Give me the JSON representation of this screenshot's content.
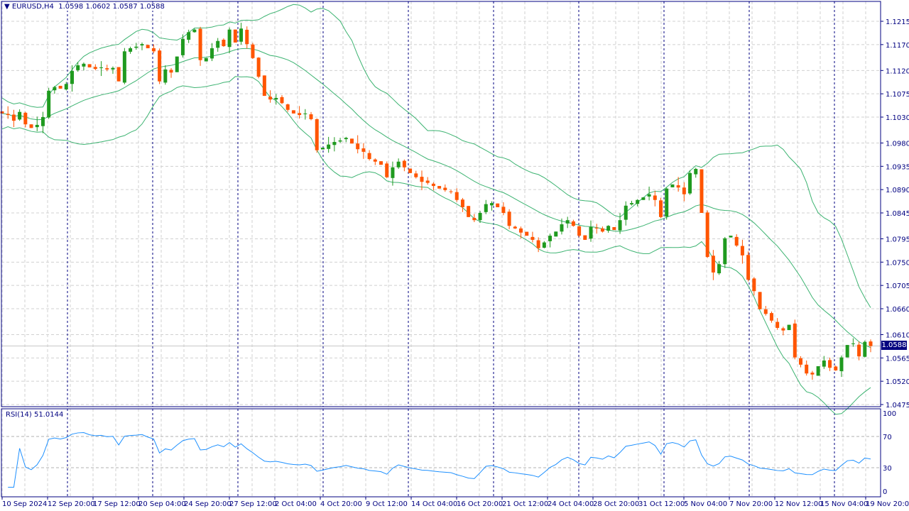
{
  "header": {
    "symbol": "EURUSD,H4",
    "open": "1.0598",
    "high": "1.0602",
    "low": "1.0587",
    "close": "1.0588"
  },
  "current_price_label": "1.0588",
  "rsi": {
    "label": "RSI(14) 51.0144",
    "period": 14,
    "levels": [
      30,
      70
    ]
  },
  "colors": {
    "axis": "#000080",
    "bull": "#1f9a1f",
    "bear": "#ff5500",
    "bands": "#3cb371",
    "rsi_line": "#1e90ff",
    "grid": "#d0d0d0"
  },
  "chart_data": {
    "type": "candlestick",
    "title": "EURUSD,H4",
    "indicators": [
      "Bollinger Bands(20,2)",
      "RSI(14)"
    ],
    "ylim": [
      1.0475,
      1.1215
    ],
    "price_ticks": [
      "1.1215",
      "1.1170",
      "1.1120",
      "1.1075",
      "1.1030",
      "1.0980",
      "1.0935",
      "1.0890",
      "1.0845",
      "1.0795",
      "1.0750",
      "1.0705",
      "1.0660",
      "1.0610",
      "1.0565",
      "1.0520",
      "1.0475"
    ],
    "rsi_ticks": [
      "100",
      "70",
      "30",
      "0"
    ],
    "time_ticks": [
      "10 Sep 2024",
      "12 Sep 20:00",
      "17 Sep 12:00",
      "20 Sep 04:00",
      "24 Sep 20:00",
      "27 Sep 12:00",
      "2 Oct 04:00",
      "4 Oct 20:00",
      "9 Oct 12:00",
      "14 Oct 04:00",
      "16 Oct 20:00",
      "21 Oct 12:00",
      "24 Oct 04:00",
      "28 Oct 20:00",
      "31 Oct 12:00",
      "5 Nov 04:00",
      "7 Nov 20:00",
      "12 Nov 12:00",
      "15 Nov 04:00",
      "19 Nov 20:00"
    ],
    "closes": [
      1.1037,
      1.1034,
      1.1023,
      1.104,
      1.1016,
      1.1009,
      1.1015,
      1.103,
      1.1081,
      1.1088,
      1.1085,
      1.1094,
      1.1119,
      1.113,
      1.1133,
      1.1126,
      1.1123,
      1.1126,
      1.1122,
      1.1125,
      1.1099,
      1.1157,
      1.1163,
      1.1166,
      1.1171,
      1.1163,
      1.1157,
      1.1099,
      1.1122,
      1.1116,
      1.1147,
      1.1181,
      1.1194,
      1.1199,
      1.114,
      1.1144,
      1.1163,
      1.1177,
      1.1167,
      1.1199,
      1.1174,
      1.1201,
      1.1171,
      1.1144,
      1.1108,
      1.1071,
      1.1064,
      1.1067,
      1.1057,
      1.1044,
      1.1037,
      1.1034,
      1.1037,
      1.1026,
      1.0966,
      1.0971,
      1.0977,
      1.0982,
      1.0985,
      1.099,
      1.0979,
      1.0968,
      1.0963,
      1.0949,
      1.0944,
      1.0938,
      1.0914,
      1.0933,
      1.0944,
      1.0933,
      1.0922,
      1.0914,
      1.0905,
      1.0903,
      1.0897,
      1.0892,
      1.0889,
      1.0886,
      1.087,
      1.0856,
      1.0837,
      1.0831,
      1.0845,
      1.0862,
      1.0864,
      1.0856,
      1.0845,
      1.082,
      1.0815,
      1.0807,
      1.0801,
      1.0793,
      1.0777,
      1.0788,
      1.0801,
      1.0809,
      1.0823,
      1.0831,
      1.082,
      1.0801,
      1.0793,
      1.0818,
      1.0815,
      1.0809,
      1.082,
      1.0812,
      1.0831,
      1.0859,
      1.0864,
      1.087,
      1.0875,
      1.0881,
      1.087,
      1.0837,
      1.0892,
      1.09,
      1.0894,
      1.0881,
      1.0922,
      1.093,
      1.0845,
      1.076,
      1.073,
      1.0746,
      1.0796,
      1.0801,
      1.0782,
      1.0763,
      1.0716,
      1.0694,
      1.0659,
      1.065,
      1.0637,
      1.0623,
      1.0618,
      1.0629,
      1.0566,
      1.0552,
      1.0535,
      1.0533,
      1.0549,
      1.056,
      1.0546,
      1.0541,
      1.0566,
      1.059,
      1.0593,
      1.0568,
      1.0596,
      1.0588
    ]
  }
}
